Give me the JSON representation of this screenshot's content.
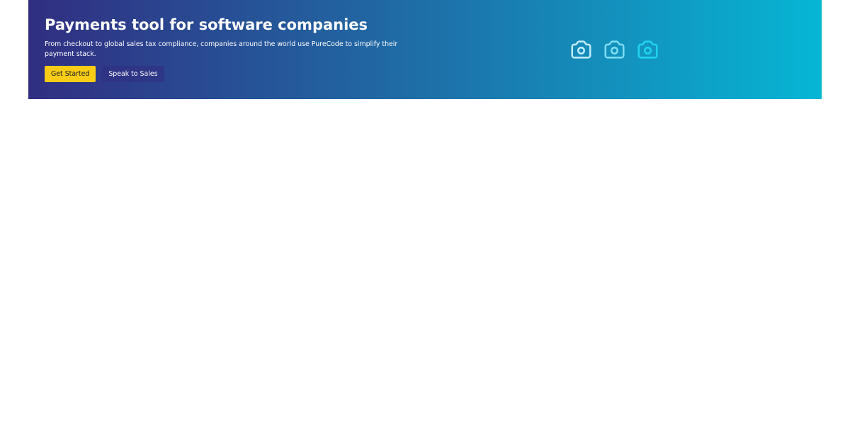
{
  "hero": {
    "title": "Payments tool for software companies",
    "subtitle": "From checkout to global sales tax compliance, companies around the world use PureCode to simplify their payment stack.",
    "primary_button": "Get Started",
    "secondary_button": "Speak to Sales",
    "gradient": [
      "#312e81",
      "#06b6d4"
    ],
    "icons": [
      {
        "name": "camera-icon",
        "color": "#bfeafc"
      },
      {
        "name": "camera-icon",
        "color": "#7ddcf3"
      },
      {
        "name": "camera-icon",
        "color": "#22d3ee"
      }
    ]
  },
  "colors": {
    "primary_button_bg": "#facc15",
    "primary_button_text": "#111827",
    "background": "#ffffff"
  }
}
